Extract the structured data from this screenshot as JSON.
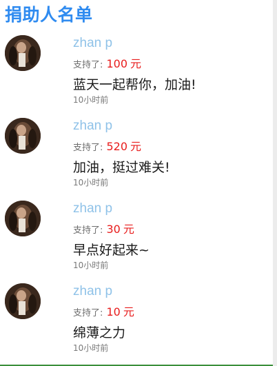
{
  "title": "捐助人名单",
  "donors": [
    {
      "name": "zhan p",
      "support_label": "支持了:",
      "amount": "100",
      "currency": "元",
      "message": "蓝天一起帮你，加油!",
      "time": "10小时前"
    },
    {
      "name": "zhan p",
      "support_label": "支持了:",
      "amount": "520",
      "currency": "元",
      "message": "加油，挺过难关!",
      "time": "10小时前"
    },
    {
      "name": "zhan p",
      "support_label": "支持了:",
      "amount": "30",
      "currency": "元",
      "message": "早点好起来~",
      "time": "10小时前"
    },
    {
      "name": "zhan p",
      "support_label": "支持了:",
      "amount": "10",
      "currency": "元",
      "message": "绵薄之力",
      "time": "10小时前"
    }
  ],
  "colors": {
    "title": "#2f8bf0",
    "donor_name": "#8fc2e8",
    "amount": "#e81c1c"
  }
}
